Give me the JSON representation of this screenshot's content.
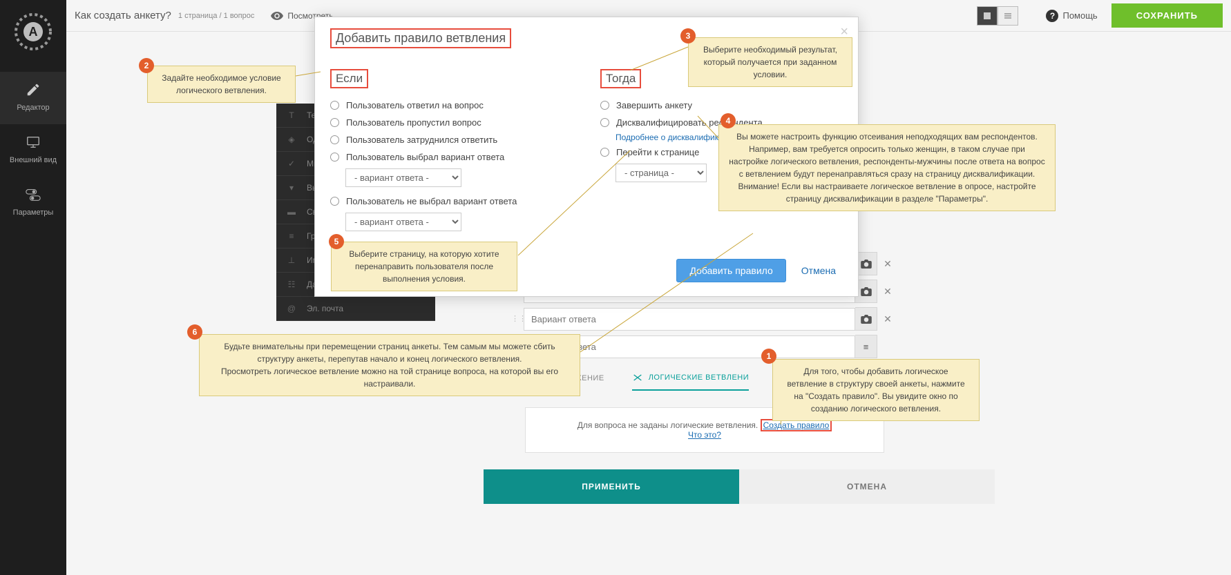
{
  "sidebar": {
    "logo_letter": "A",
    "items": [
      {
        "label": "Редактор"
      },
      {
        "label": "Внешний вид"
      },
      {
        "label": "Параметры"
      }
    ]
  },
  "topbar": {
    "title": "Как создать анкету?",
    "subtitle": "1 страница / 1 вопрос",
    "preview": "Посмотреть",
    "help": "Помощь",
    "save": "СОХРАНИТЬ"
  },
  "qtypes": [
    "Те",
    "Од",
    "Мн",
    "Вы",
    "Св",
    "Группа",
    "Имя",
    "Дата",
    "Эл. почта"
  ],
  "answers": {
    "placeholder": "Вариант ответа"
  },
  "subtabs": {
    "display": "ОТОБРАЖЕНИЕ",
    "logic": "ЛОГИЧЕСКИЕ ВЕТВЛЕНИ"
  },
  "branch_msg": {
    "text": "Для вопроса не заданы логические ветвления.",
    "create_link": "Создать правило",
    "what": "Что это?"
  },
  "bottom": {
    "apply": "ПРИМЕНИТЬ",
    "cancel": "ОТМЕНА"
  },
  "modal": {
    "title": "Добавить правило ветвления",
    "if_head": "Если",
    "then_head": "Тогда",
    "conditions": [
      "Пользователь ответил на вопрос",
      "Пользователь пропустил вопрос",
      "Пользователь затруднился ответить",
      "Пользователь выбрал вариант ответа",
      "Пользователь не выбрал вариант ответа"
    ],
    "option_select": "- вариант ответа -",
    "results": [
      "Завершить анкету",
      "Дисквалифицировать респондента",
      "Перейти к странице"
    ],
    "disq_link": "Подробнее о дисквалификации",
    "page_select": "- страница -",
    "add_btn": "Добавить правило",
    "cancel_btn": "Отмена"
  },
  "callouts": {
    "c1": "Для того, чтобы добавить логическое ветвление в структуру своей анкеты, нажмите на \"Создать правило\". Вы увидите окно по созданию логического ветвления.",
    "c2": "Задайте необходимое условие логического ветвления.",
    "c3": "Выберите необходимый результат, который получается при заданном условии.",
    "c4": "Вы можете настроить функцию отсеивания неподходящих вам респондентов. Например, вам требуется опросить только женщин, в таком случае при настройке логического ветвления, респонденты-мужчины после ответа на вопрос с ветвлением будут перенаправляться сразу на страницу дисквалификации.\nВнимание! Если вы настраиваете логическое ветвление в опросе, настройте страницу дисквалификации в разделе \"Параметры\".",
    "c5": "Выберите страницу, на которую хотите перенаправить пользователя после выполнения условия.",
    "c6": "Будьте внимательны при перемещении страниц анкеты. Тем самым мы можете сбить структуру анкеты, перепутав начало и конец логического ветвления.\nПросмотреть логическое ветвление можно на той странице вопроса, на которой вы его настраивали."
  }
}
